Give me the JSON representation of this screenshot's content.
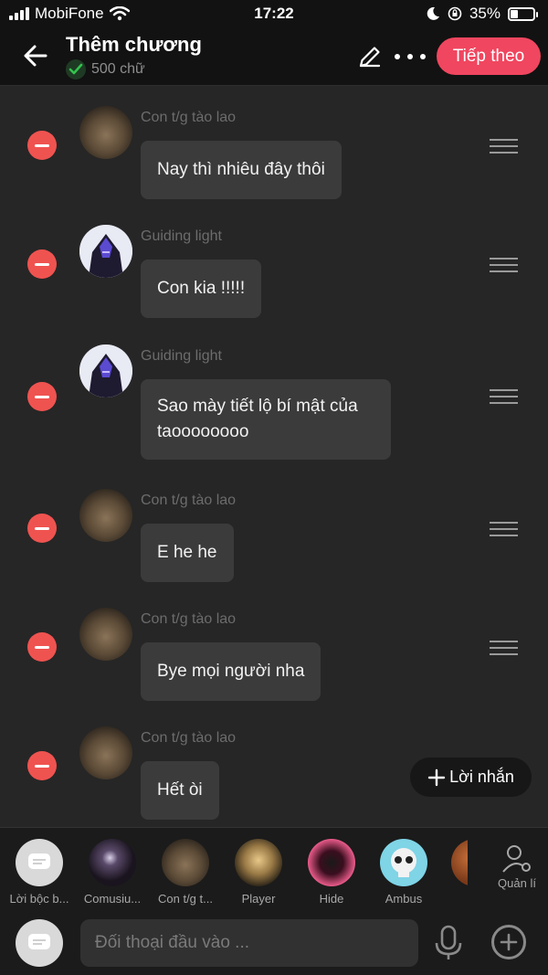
{
  "status_bar": {
    "carrier": "MobiFone",
    "time": "17:22",
    "battery": "35%",
    "battery_level": 0.35
  },
  "header": {
    "title": "Thêm chương",
    "word_count": "500 chữ",
    "next_label": "Tiếp theo"
  },
  "messages": [
    {
      "author": "Con t/g tào lao",
      "text": "Nay thì nhiêu đây thôi"
    },
    {
      "author": "Guiding light",
      "text": "Con kia !!!!!"
    },
    {
      "author": "Guiding light",
      "text": "Sao mày tiết lộ bí mật của taoooooooo"
    },
    {
      "author": "Con t/g tào lao",
      "text": "E he he"
    },
    {
      "author": "Con t/g tào lao",
      "text": "Bye mọi người nha"
    },
    {
      "author": "Con t/g tào lao",
      "text": "Hết òi"
    }
  ],
  "add_message_label": "Lời nhắn",
  "characters": [
    {
      "label": "Lời bộc b..."
    },
    {
      "label": "Comusiu..."
    },
    {
      "label": "Con t/g t..."
    },
    {
      "label": "Player"
    },
    {
      "label": "Hide"
    },
    {
      "label": "Ambus"
    }
  ],
  "manage_label": "Quản lí",
  "input": {
    "placeholder": "Đối thoại đầu vào ..."
  },
  "colors": {
    "accent": "#f0465f",
    "remove": "#ef5350",
    "background": "#262626",
    "bubble": "#3b3b3b"
  },
  "icons": [
    "back-arrow-icon",
    "check-icon",
    "pen-icon",
    "more-icon",
    "minus-icon",
    "drag-handle-icon",
    "plus-icon",
    "chat-bubble-icon",
    "person-gear-icon",
    "mic-icon",
    "circle-plus-icon"
  ]
}
